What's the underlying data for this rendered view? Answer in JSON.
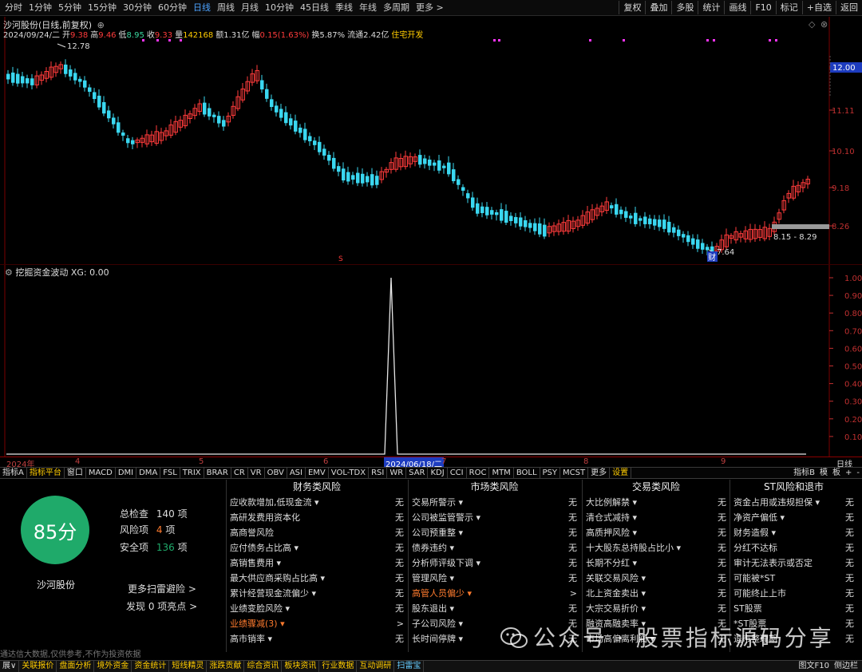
{
  "toolbar": {
    "periods": [
      "分时",
      "1分钟",
      "5分钟",
      "15分钟",
      "30分钟",
      "60分钟",
      "日线",
      "周线",
      "月线",
      "10分钟",
      "45日线",
      "季线",
      "年线",
      "多周期",
      "更多 >"
    ],
    "active_period": "日线",
    "tools": [
      "复权",
      "叠加",
      "多股",
      "统计",
      "画线",
      "F10",
      "标记",
      "+自选",
      "返回"
    ]
  },
  "header": {
    "stock_title": "沙河股份(日线,前复权)",
    "date": "2024/09/24/二",
    "open_label": "开",
    "open": "9.38",
    "high_label": "高",
    "high": "9.46",
    "low_label": "低",
    "low": "8.95",
    "close_label": "收",
    "close": "9.33",
    "volume_label": "量",
    "volume": "142168",
    "amount_label": "额",
    "amount": "1.31亿",
    "change_label": "幅",
    "change": "0.15(1.63%)",
    "turnover_label": "换",
    "turnover": "5.87%",
    "float_label": "流通",
    "float": "2.42亿",
    "sector": "住宅开发"
  },
  "main_chart": {
    "y_labels": [
      "12.00",
      "11.11",
      "10.10",
      "9.18",
      "8.26"
    ],
    "current_price_tag": "12.00",
    "high_marker": "12.78",
    "low_marker": "7.64",
    "range_label": "8.15 - 8.29",
    "event_marker": "财",
    "s_marker": "S"
  },
  "indicator": {
    "title": "挖掘资金波动 XG: 0.00",
    "y_labels": [
      "1.00",
      "0.90",
      "0.80",
      "0.70",
      "0.60",
      "0.50",
      "0.40",
      "0.30",
      "0.20",
      "0.10"
    ]
  },
  "date_axis": {
    "labels": [
      "2024年",
      "4",
      "5",
      "6",
      "7",
      "8",
      "9"
    ],
    "selected_date": "2024/06/18/二",
    "period": "日线"
  },
  "indicator_tabs": {
    "tabs": [
      "指标A",
      "指标平台",
      "窗口",
      "MACD",
      "DMI",
      "DMA",
      "FSL",
      "TRIX",
      "BRAR",
      "CR",
      "VR",
      "OBV",
      "ASI",
      "EMV",
      "VOL-TDX",
      "RSI",
      "WR",
      "SAR",
      "KDJ",
      "CCI",
      "ROC",
      "MTM",
      "BOLL",
      "PSY",
      "MCST",
      "更多",
      "设置"
    ],
    "right": [
      "指标B",
      "模",
      "板",
      "+",
      "-"
    ]
  },
  "risk": {
    "score": "85分",
    "stock_name": "沙河股份",
    "total_label": "总检查",
    "total": "140",
    "total_unit": "项",
    "risk_label": "风险项",
    "risk": "4",
    "risk_unit": "项",
    "safe_label": "安全项",
    "safe": "136",
    "safe_unit": "项",
    "more_scan": "更多扫雷避险 >",
    "highlights": "发现 0 项亮点 >",
    "disclaimer": "通达信大数据,仅供参考,不作为投资依据",
    "columns": [
      {
        "title": "财务类风险",
        "rows": [
          {
            "name": "应收款增加,低现金流 ▾",
            "status": "无"
          },
          {
            "name": "高研发费用资本化",
            "status": "无"
          },
          {
            "name": "高商誉风险",
            "status": "无"
          },
          {
            "name": "应付债务占比高 ▾",
            "status": "无"
          },
          {
            "name": "高销售费用 ▾",
            "status": "无"
          },
          {
            "name": "最大供应商采购占比高 ▾",
            "status": "无"
          },
          {
            "name": "累计经营现金流偏少 ▾",
            "status": "无"
          },
          {
            "name": "业绩变脸风险 ▾",
            "status": "无"
          },
          {
            "name": "业绩骤减(3) ▾",
            "status": ">",
            "hot": true
          },
          {
            "name": "高市销率 ▾",
            "status": "无"
          }
        ]
      },
      {
        "title": "市场类风险",
        "rows": [
          {
            "name": "交易所警示 ▾",
            "status": "无"
          },
          {
            "name": "公司被监管警示 ▾",
            "status": "无"
          },
          {
            "name": "公司预重整 ▾",
            "status": "无"
          },
          {
            "name": "债券违约 ▾",
            "status": "无"
          },
          {
            "name": "分析师评级下调 ▾",
            "status": "无"
          },
          {
            "name": "管理风险 ▾",
            "status": "无"
          },
          {
            "name": "高管人员偏少 ▾",
            "status": ">",
            "hot": true
          },
          {
            "name": "股东退出 ▾",
            "status": "无"
          },
          {
            "name": "子公司风险 ▾",
            "status": "无"
          },
          {
            "name": "长时间停牌 ▾",
            "status": "无"
          }
        ]
      },
      {
        "title": "交易类风险",
        "rows": [
          {
            "name": "大比例解禁 ▾",
            "status": "无"
          },
          {
            "name": "清仓式减持 ▾",
            "status": "无"
          },
          {
            "name": "高质押风险 ▾",
            "status": "无"
          },
          {
            "name": "十大股东总持股占比小 ▾",
            "status": "无"
          },
          {
            "name": "长期不分红 ▾",
            "status": "无"
          },
          {
            "name": "关联交易风险 ▾",
            "status": "无"
          },
          {
            "name": "北上资金卖出 ▾",
            "status": "无"
          },
          {
            "name": "大宗交易折价 ▾",
            "status": "无"
          },
          {
            "name": "融资高融卖率 ▾",
            "status": "无"
          },
          {
            "name": "市场高偏离利润 ▾",
            "status": "无"
          }
        ]
      },
      {
        "title": "ST风险和退市",
        "rows": [
          {
            "name": "资金占用或违规担保 ▾",
            "status": "无"
          },
          {
            "name": "净资产偏低 ▾",
            "status": "无"
          },
          {
            "name": "财务造假 ▾",
            "status": "无"
          },
          {
            "name": "分红不达标",
            "status": "无"
          },
          {
            "name": "审计无法表示或否定",
            "status": "无"
          },
          {
            "name": "可能被*ST",
            "status": "无"
          },
          {
            "name": "可能终止上市",
            "status": "无"
          },
          {
            "name": "ST股票",
            "status": "无"
          },
          {
            "name": "*ST股票",
            "status": "无"
          },
          {
            "name": "退市整理期",
            "status": "无"
          }
        ]
      }
    ]
  },
  "statusbar": {
    "items": [
      "展∨",
      "关联报价",
      "盘面分析",
      "境外资金",
      "资金统计",
      "短线精灵",
      "涨跌贡献",
      "综合资讯",
      "板块资讯",
      "行业数据",
      "互动调研",
      "扫雷宝"
    ],
    "right": [
      "图文F10",
      "侧边栏"
    ]
  },
  "watermark": {
    "text": "公众号 · 股票指标源码分享"
  },
  "colors": {
    "up": "#ff3b3b",
    "down": "#3ad7f0",
    "accent_blue": "#4da3ff",
    "score_green": "#1faa6a",
    "warning_orange": "#ff7b2e"
  }
}
